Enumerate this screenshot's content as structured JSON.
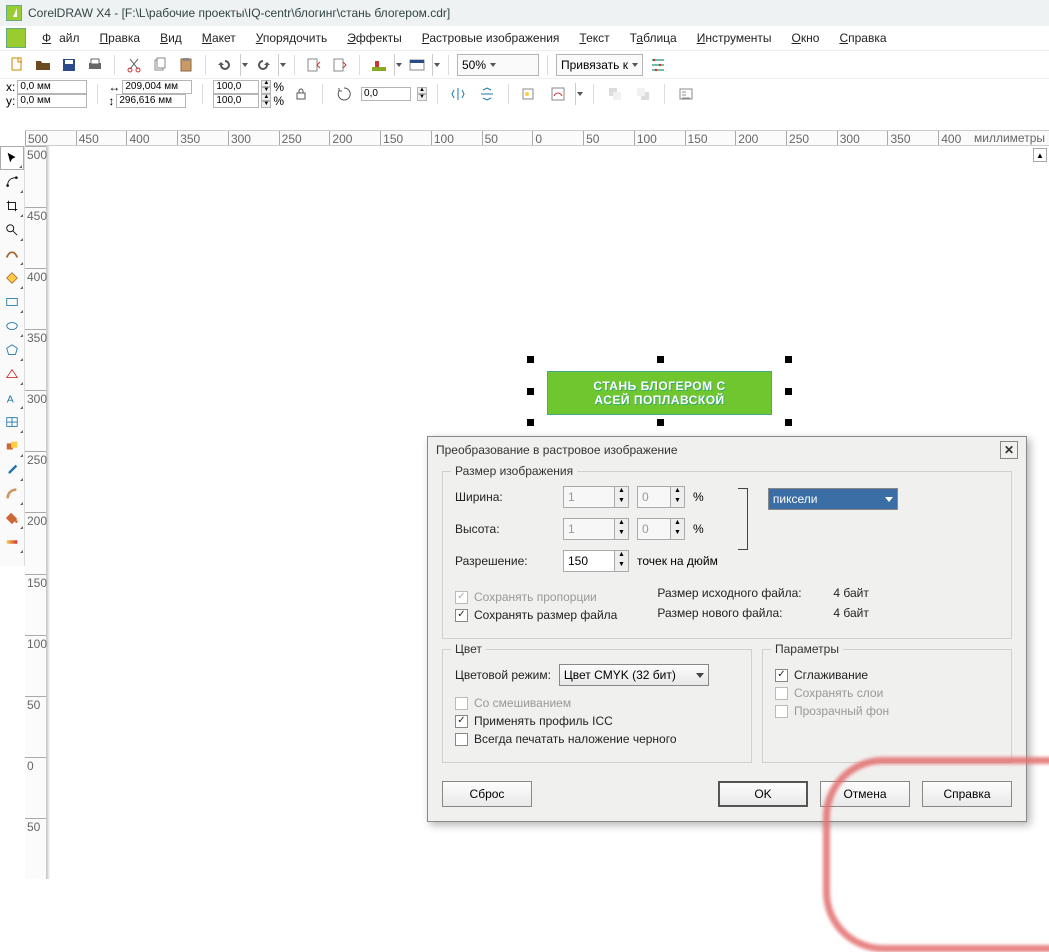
{
  "title": "CorelDRAW X4 - [F:\\L\\рабочие проекты\\IQ-centr\\блогинг\\стань блогером.cdr]",
  "menu": {
    "file": "Файл",
    "edit": "Правка",
    "view": "Вид",
    "layout": "Макет",
    "arrange": "Упорядочить",
    "effects": "Эффекты",
    "bitmaps": "Растровые изображения",
    "text": "Текст",
    "table": "Таблица",
    "tools": "Инструменты",
    "window": "Окно",
    "help": "Справка"
  },
  "toolbar": {
    "zoom": "50%",
    "snap": "Привязать к"
  },
  "props": {
    "x_lbl": "x:",
    "x": "0,0 мм",
    "y_lbl": "y:",
    "y": "0,0 мм",
    "w": "209,004 мм",
    "h": "296,616 мм",
    "sx": "100,0",
    "sy": "100,0",
    "rot": "0,0"
  },
  "ruler_units": "миллиметры",
  "hruler": [
    "500",
    "450",
    "400",
    "350",
    "300",
    "250",
    "200",
    "150",
    "100",
    "50",
    "0",
    "50",
    "100",
    "150",
    "200",
    "250",
    "300",
    "350",
    "400"
  ],
  "vruler": [
    "500",
    "450",
    "400",
    "350",
    "300",
    "250",
    "200",
    "150",
    "100",
    "50",
    "0",
    "50"
  ],
  "banner": {
    "l1": "СТАНЬ БЛОГЕРОМ С",
    "l2": "АСЕЙ ПОПЛАВСКОЙ"
  },
  "dialog": {
    "title": "Преобразование в растровое изображение",
    "grp_size": "Размер изображения",
    "width_lbl": "Ширина:",
    "width": "1",
    "width_pct": "0",
    "height_lbl": "Высота:",
    "height": "1",
    "height_pct": "0",
    "pct": "%",
    "units_sel": "пиксели",
    "res_lbl": "Разрешение:",
    "res": "150",
    "res_unit": "точек на дюйм",
    "keep_ratio": "Сохранять пропорции",
    "keep_size": "Сохранять размер файла",
    "src_size_lbl": "Размер исходного файла:",
    "src_size": "4 байт",
    "new_size_lbl": "Размер нового файла:",
    "new_size": "4 байт",
    "grp_color": "Цвет",
    "color_mode_lbl": "Цветовой режим:",
    "color_mode": "Цвет CMYK (32 бит)",
    "dither": "Со смешиванием",
    "apply_icc": "Применять профиль ICC",
    "overprint": "Всегда печатать наложение черного",
    "grp_params": "Параметры",
    "antialias": "Сглаживание",
    "layers": "Сохранять слои",
    "transparent": "Прозрачный фон",
    "reset": "Сброс",
    "ok": "OK",
    "cancel": "Отмена",
    "help": "Справка"
  }
}
